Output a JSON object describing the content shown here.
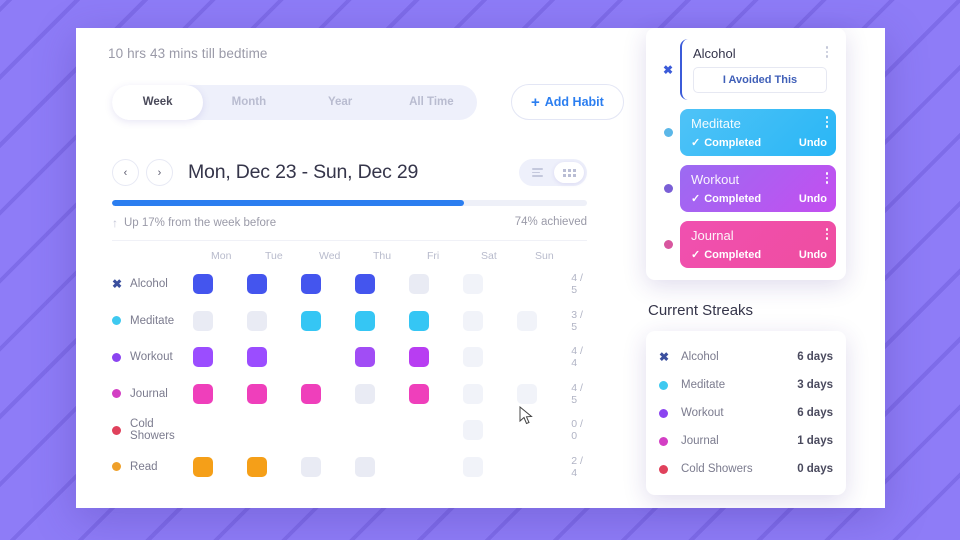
{
  "header": {
    "bedtime": "10 hrs 43 mins till bedtime"
  },
  "tabs": [
    {
      "label": "Week",
      "active": true
    },
    {
      "label": "Month",
      "active": false
    },
    {
      "label": "Year",
      "active": false
    },
    {
      "label": "All Time",
      "active": false
    }
  ],
  "add_habit": {
    "plus": "+",
    "label": "Add Habit"
  },
  "week_nav": {
    "prev": "‹",
    "next": "›",
    "title": "Mon, Dec 23 - Sun, Dec 29"
  },
  "view_toggle": {
    "list": "list-view",
    "grid": "grid-view",
    "active": "grid"
  },
  "progress": {
    "percent": 74,
    "fill_width": "74%",
    "trend_arrow": "↑",
    "trend_text": "Up 17% from the week before",
    "achieved_text": "74% achieved"
  },
  "grid": {
    "days": [
      "Mon",
      "Tue",
      "Wed",
      "Thu",
      "Fri",
      "Sat",
      "Sun"
    ],
    "rows": [
      {
        "name": "Alcohol",
        "icon": "x-mark",
        "color": "#3b4f9e",
        "cells": [
          "#4455ee",
          "#4455ee",
          "#4455ee",
          "#4455ee",
          "empty",
          "faint",
          "none"
        ],
        "fraction": "4 / 5"
      },
      {
        "name": "Meditate",
        "icon": "dot",
        "color": "#3ec9f0",
        "cells": [
          "empty",
          "empty",
          "#35c6f4",
          "#35c6f4",
          "#35c6f4",
          "faint",
          "faint"
        ],
        "fraction": "3 / 5"
      },
      {
        "name": "Workout",
        "icon": "dot",
        "color": "#8b44f0",
        "cells": [
          "#9b4dff",
          "#9b4dff",
          "none",
          "#a14df5",
          "#b83df2",
          "faint",
          "none"
        ],
        "fraction": "4 / 4"
      },
      {
        "name": "Journal",
        "icon": "dot",
        "color": "#d33fc4",
        "cells": [
          "#ef3fbb",
          "#ef3fbb",
          "#ef3fbb",
          "empty",
          "#ef3fbb",
          "faint",
          "faint"
        ],
        "fraction": "4 / 5"
      },
      {
        "name": "Cold Showers",
        "icon": "dot",
        "color": "#e0415c",
        "cells": [
          "none",
          "none",
          "none",
          "none",
          "none",
          "faint",
          "none"
        ],
        "fraction": "0 / 0"
      },
      {
        "name": "Read",
        "icon": "dot",
        "color": "#efa02a",
        "cells": [
          "#f59f18",
          "#f59f18",
          "empty",
          "empty",
          "none",
          "faint",
          "none"
        ],
        "fraction": "2 / 4"
      }
    ]
  },
  "habit_cards": [
    {
      "title": "Alcohol",
      "type": "avoid",
      "icon": "x-mark",
      "icon_color": "#3b5bd9",
      "action_label": "I Avoided This",
      "accent": "#3b5bd9"
    },
    {
      "title": "Meditate",
      "type": "completed",
      "icon": "dot",
      "icon_color": "#5bb7e8",
      "status": "Completed",
      "check": "✓",
      "undo": "Undo",
      "grad_from": "#4fc3f7",
      "grad_to": "#29b6f6"
    },
    {
      "title": "Workout",
      "type": "completed",
      "icon": "dot",
      "icon_color": "#7a5fd6",
      "status": "Completed",
      "check": "✓",
      "undo": "Undo",
      "grad_from": "#9b6bf2",
      "grad_to": "#c44ef0"
    },
    {
      "title": "Journal",
      "type": "completed",
      "icon": "dot",
      "icon_color": "#d8569f",
      "status": "Completed",
      "check": "✓",
      "undo": "Undo",
      "grad_from": "#f050b0",
      "grad_to": "#ef4da0"
    }
  ],
  "streaks": {
    "title": "Current Streaks",
    "items": [
      {
        "name": "Alcohol",
        "icon": "x-mark",
        "color": "#3b4f9e",
        "days": "6 days"
      },
      {
        "name": "Meditate",
        "icon": "dot",
        "color": "#3ec9f0",
        "days": "3 days"
      },
      {
        "name": "Workout",
        "icon": "dot",
        "color": "#8b44f0",
        "days": "6 days"
      },
      {
        "name": "Journal",
        "icon": "dot",
        "color": "#d33fc4",
        "days": "1 days"
      },
      {
        "name": "Cold Showers",
        "icon": "dot",
        "color": "#e0415c",
        "days": "0 days"
      }
    ]
  }
}
